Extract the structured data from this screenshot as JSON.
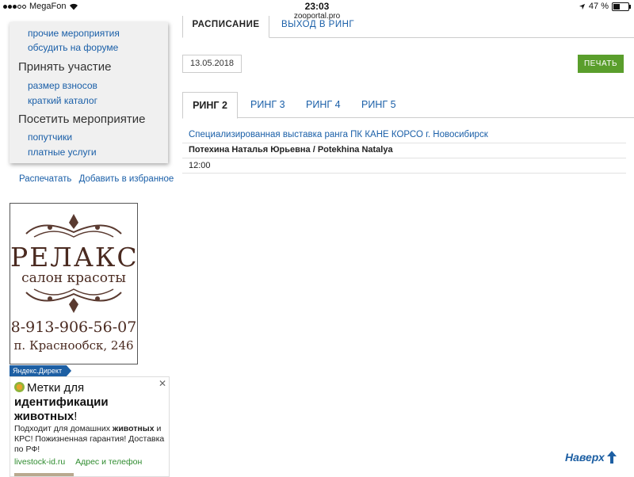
{
  "statusbar": {
    "carrier": "MegaFon",
    "time": "23:03",
    "url": "zooportal.pro",
    "battery": "47 %"
  },
  "sidebar": {
    "links_top": [
      "прочие мероприятия",
      "обсудить на форуме"
    ],
    "section_participate": {
      "title": "Принять участие",
      "links": [
        "размер взносов",
        "краткий каталог"
      ]
    },
    "section_visit": {
      "title": "Посетить мероприятие",
      "links": [
        "попутчики",
        "платные услуги"
      ]
    },
    "actions": {
      "print": "Распечатать",
      "favorite": "Добавить в избранное"
    }
  },
  "banner": {
    "title": "РЕЛАКС",
    "subtitle": "салон красоты",
    "phone": "8-913-906-56-07",
    "address": "п. Краснообск, 246"
  },
  "ad": {
    "label": "Яндекс.Директ",
    "headline_part1": "Метки для ",
    "headline_bold": "идентификации животных",
    "headline_end": "!",
    "body_part1": "Подходит для домашних ",
    "body_bold": "животных",
    "body_part2": " и КРС! Пожизненная гарантия! Доставка по РФ!",
    "link_site": "livestock-id.ru",
    "link_contacts": "Адрес и телефон",
    "close": "✕"
  },
  "main": {
    "tabs": [
      {
        "label": "РАСПИСАНИЕ",
        "active": true
      },
      {
        "label": "ВЫХОД В РИНГ",
        "active": false
      }
    ],
    "date": "13.05.2018",
    "print_button": "ПЕЧАТЬ",
    "rings": [
      {
        "label": "РИНГ 2",
        "active": true
      },
      {
        "label": "РИНГ 3",
        "active": false
      },
      {
        "label": "РИНГ 4",
        "active": false
      },
      {
        "label": "РИНГ 5",
        "active": false
      }
    ],
    "schedule": {
      "event": "Специализированная выставка ранга ПК КАНЕ КОРСО г. Новосибирск",
      "judge": "Потехина Наталья Юрьевна / Potekhina Natalya",
      "time": "12:00"
    }
  },
  "scroll_top": "Наверх"
}
